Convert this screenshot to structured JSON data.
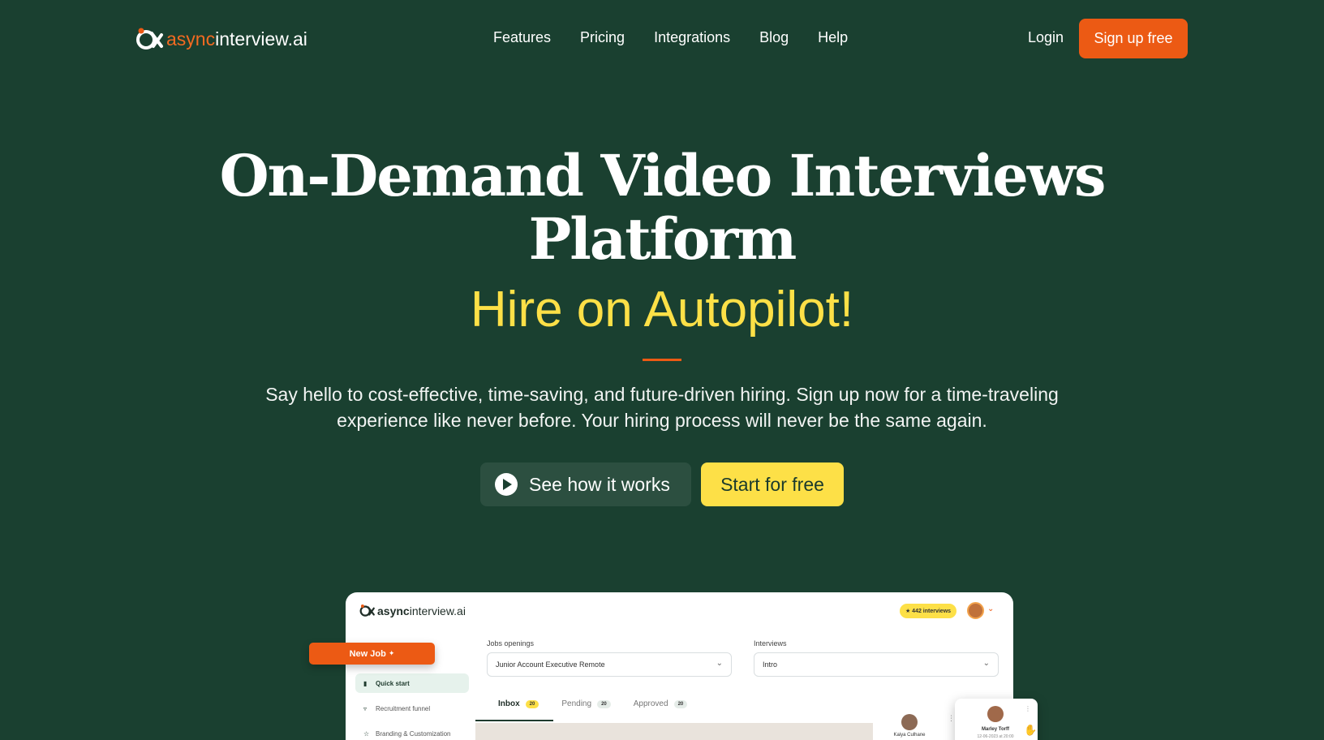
{
  "nav": {
    "logo": {
      "part1": "async",
      "part2": "interview.ai"
    },
    "links": [
      "Features",
      "Pricing",
      "Integrations",
      "Blog",
      "Help"
    ],
    "login": "Login",
    "signup": "Sign up free"
  },
  "hero": {
    "title_line1": "On-Demand Video Interviews",
    "title_line2": "Platform",
    "subtitle": "Hire on Autopilot!",
    "lead_line1": "Say hello to cost-effective, time-saving, and future-driven hiring. Sign up now for a time-traveling",
    "lead_line2": "experience like never before. Your hiring process will never be the same again.",
    "cta_secondary": "See how it works",
    "cta_primary": "Start for free"
  },
  "app": {
    "logo_bold": "async",
    "logo_rest": "interview.ai",
    "badge": "★ 442 interviews",
    "new_job": "New Job",
    "jobs_label": "Jobs openings",
    "jobs_value": "Junior Account Executive Remote",
    "interviews_label": "Interviews",
    "interviews_value": "Intro",
    "sidebar": [
      {
        "label": "Quick start",
        "icon": "briefcase-icon"
      },
      {
        "label": "Recruitment funnel",
        "icon": "funnel-icon"
      },
      {
        "label": "Branding & Customization",
        "icon": "star-icon"
      }
    ],
    "tabs": [
      {
        "label": "Inbox",
        "count": "20"
      },
      {
        "label": "Pending",
        "count": "20"
      },
      {
        "label": "Approved",
        "count": "20"
      }
    ],
    "candidate1": "Kaiya Culhane",
    "candidate2": "Marley Torff",
    "candidate2_date": "12-06-2023 at 20:00"
  },
  "colors": {
    "background": "#1a4030",
    "accent_orange": "#ec5a14",
    "accent_yellow": "#fde047"
  }
}
